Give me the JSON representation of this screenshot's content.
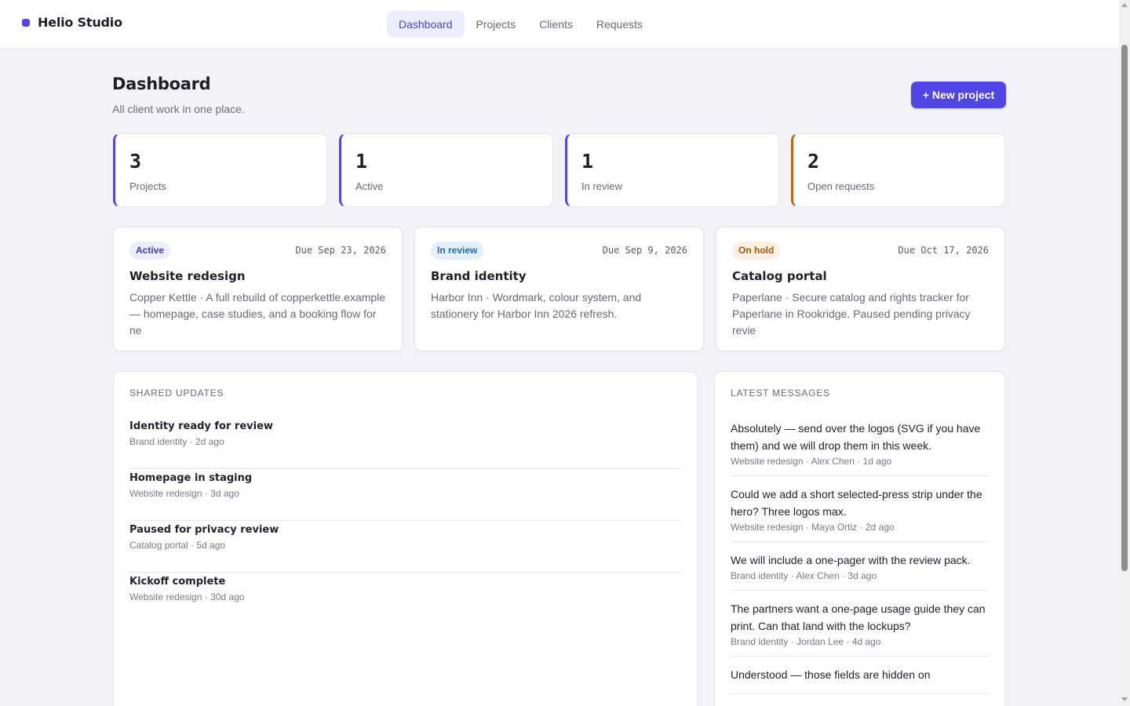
{
  "app": {
    "name": "Helio Studio",
    "brand_color": "#5145e5"
  },
  "nav": {
    "items": [
      {
        "label": "Dashboard",
        "active": true
      },
      {
        "label": "Projects",
        "active": false
      },
      {
        "label": "Clients",
        "active": false
      },
      {
        "label": "Requests",
        "active": false
      }
    ]
  },
  "header": {
    "title": "Dashboard",
    "subtitle": "All client work in one place.",
    "new_project_label": "+ New project"
  },
  "stats": [
    {
      "value": "3",
      "label": "Projects",
      "accent": "#5046e5"
    },
    {
      "value": "1",
      "label": "Active",
      "accent": "#5046e5"
    },
    {
      "value": "1",
      "label": "In review",
      "accent": "#5046e5"
    },
    {
      "value": "2",
      "label": "Open requests",
      "accent": "#c5620f"
    }
  ],
  "projects": [
    {
      "status": "Active",
      "due": "Due Sep 23, 2026",
      "name": "Website redesign",
      "description": "Copper Kettle · A full rebuild of copperkettle.example — homepage, case studies, and a booking flow for ne"
    },
    {
      "status": "In review",
      "due": "Due Sep 9, 2026",
      "name": "Brand identity",
      "description": "Harbor Inn · Wordmark, colour system, and stationery for Harbor Inn 2026 refresh."
    },
    {
      "status": "On hold",
      "due": "Due Oct 17, 2026",
      "name": "Catalog portal",
      "description": "Paperlane · Secure catalog and rights tracker for Paperlane in Rookridge. Paused pending privacy revie"
    }
  ],
  "updates": {
    "title": "SHARED UPDATES",
    "items": [
      {
        "title": "Identity ready for review",
        "meta": "Brand identity · 2d ago"
      },
      {
        "title": "Homepage in staging",
        "meta": "Website redesign · 3d ago"
      },
      {
        "title": "Paused for privacy review",
        "meta": "Catalog portal · 5d ago"
      },
      {
        "title": "Kickoff complete",
        "meta": "Website redesign · 30d ago"
      }
    ]
  },
  "messages": {
    "title": "LATEST MESSAGES",
    "items": [
      {
        "text": "Absolutely — send over the logos (SVG if you have them) and we will drop them in this week.",
        "meta": "Website redesign · Alex Chen · 1d ago"
      },
      {
        "text": "Could we add a short selected-press strip under the hero? Three logos max.",
        "meta": "Website redesign · Maya Ortiz · 2d ago"
      },
      {
        "text": "We will include a one-pager with the review pack.",
        "meta": "Brand identity · Alex Chen · 3d ago"
      },
      {
        "text": "The partners want a one-page usage guide they can print. Can that land with the lockups?",
        "meta": "Brand identity · Jordan Lee · 4d ago"
      },
      {
        "text": "Understood — those fields are hidden on",
        "meta": ""
      }
    ]
  }
}
